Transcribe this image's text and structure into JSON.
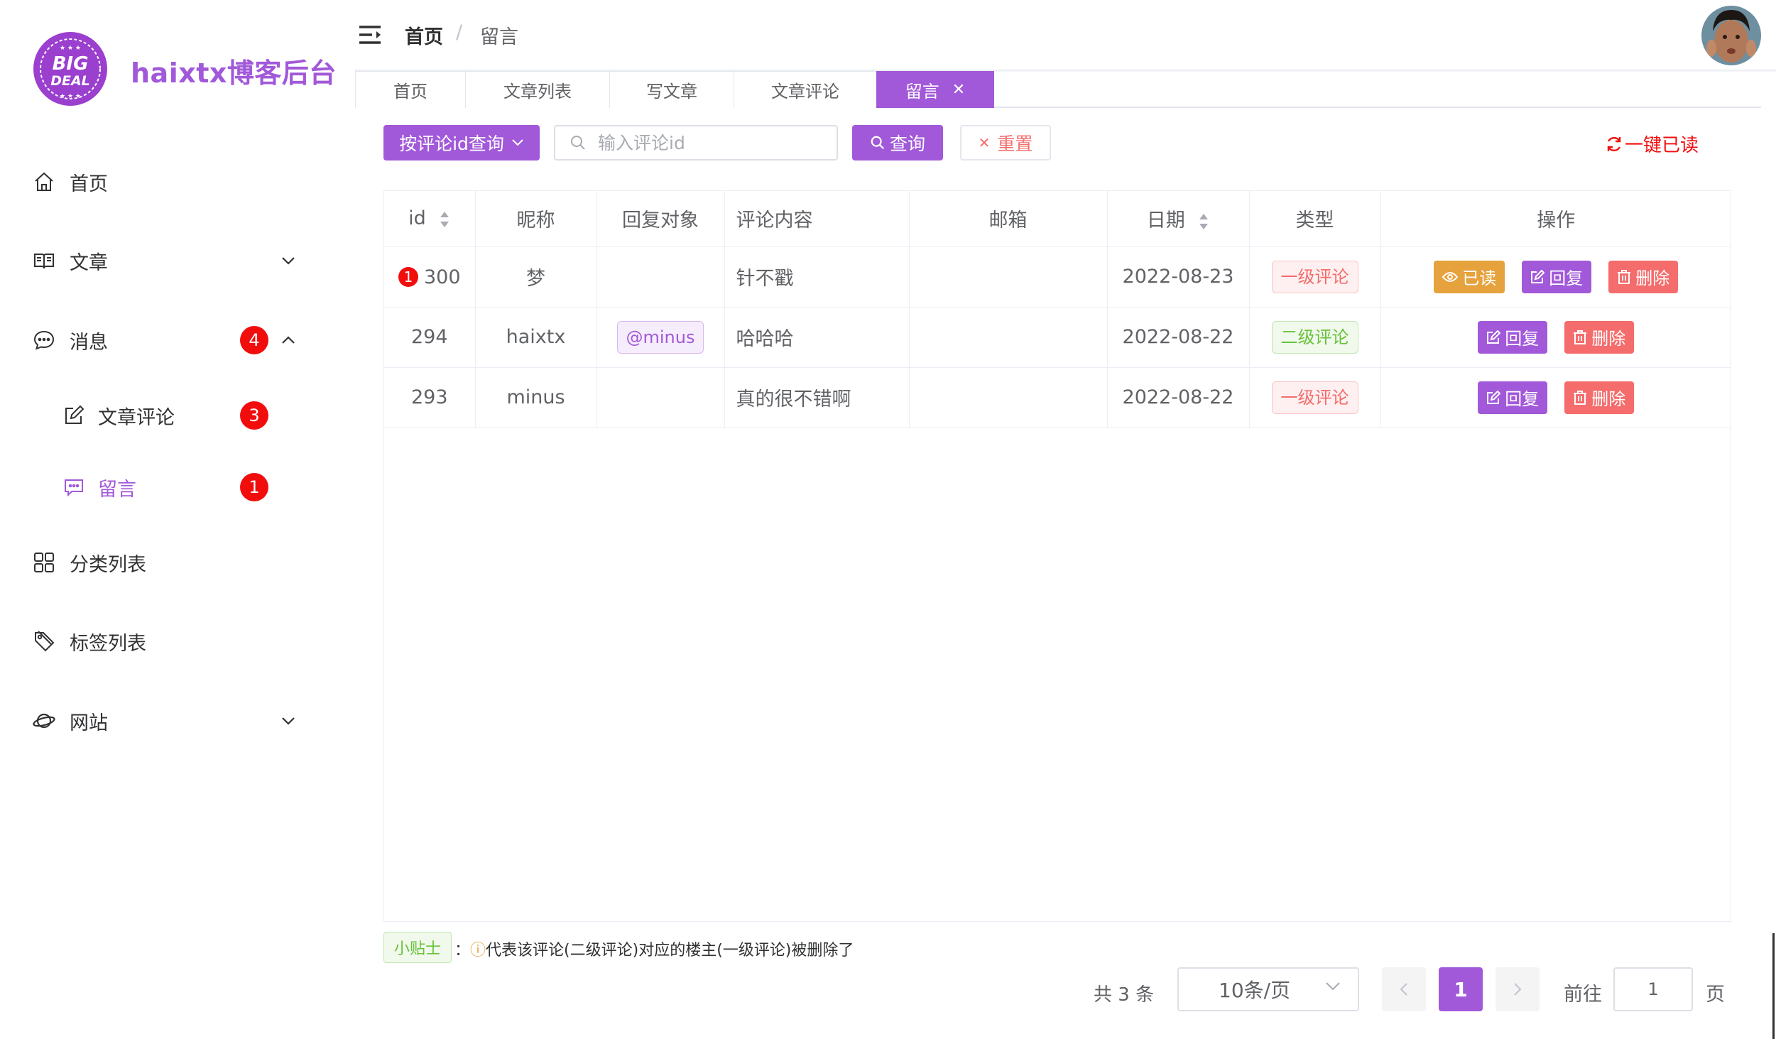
{
  "sidebar": {
    "brand": "haixtx博客后台",
    "logo_text": [
      "BIG",
      "DEAL"
    ],
    "items": [
      {
        "label": "首页",
        "icon": "home-icon"
      },
      {
        "label": "文章",
        "icon": "book-icon"
      },
      {
        "label": "消息",
        "icon": "chat-icon",
        "badge": "4"
      },
      {
        "label": "文章评论",
        "icon": "edit-icon",
        "badge": "3"
      },
      {
        "label": "留言",
        "icon": "message-icon",
        "badge": "1"
      },
      {
        "label": "分类列表",
        "icon": "grid-icon"
      },
      {
        "label": "标签列表",
        "icon": "tag-icon"
      },
      {
        "label": "网站",
        "icon": "planet-icon"
      }
    ]
  },
  "header": {
    "breadcrumb": [
      "首页",
      "/",
      "留言"
    ]
  },
  "tabs": [
    {
      "label": "首页"
    },
    {
      "label": "文章列表"
    },
    {
      "label": "写文章"
    },
    {
      "label": "文章评论"
    },
    {
      "label": "留言",
      "active": true
    }
  ],
  "toolbar": {
    "query_type": "按评论id查询",
    "search_placeholder": "输入评论id",
    "search_label": "查询",
    "reset_label": "重置",
    "mark_all_read": "一键已读"
  },
  "table": {
    "headers": [
      "id",
      "昵称",
      "回复对象",
      "评论内容",
      "邮箱",
      "日期",
      "类型",
      "操作"
    ],
    "rows": [
      {
        "unread_dot": "1",
        "id": "300",
        "nickname": "梦",
        "reply_to": "",
        "content": "针不戳",
        "email": "",
        "date": "2022-08-23",
        "type": "一级评论",
        "actions": [
          "已读",
          "回复",
          "删除"
        ]
      },
      {
        "unread_dot": "",
        "id": "294",
        "nickname": "haixtx",
        "reply_to": "@minus",
        "content": "哈哈哈",
        "email": "",
        "date": "2022-08-22",
        "type": "二级评论",
        "actions": [
          "回复",
          "删除"
        ]
      },
      {
        "unread_dot": "",
        "id": "293",
        "nickname": "minus",
        "reply_to": "",
        "content": "真的很不错啊",
        "email": "",
        "date": "2022-08-22",
        "type": "一级评论",
        "actions": [
          "回复",
          "删除"
        ]
      }
    ]
  },
  "tip": {
    "label": "小贴士",
    "colon": "：",
    "icon_char": "ⓘ",
    "text": "代表该评论(二级评论)对应的楼主(一级评论)被删除了"
  },
  "pagination": {
    "total": "共 3 条",
    "page_size": "10条/页",
    "current": "1",
    "goto_label": "前往",
    "goto_value": "1",
    "page_label": "页"
  },
  "colors": {
    "accent": "#a259d9",
    "danger": "#f56c6c",
    "warning": "#e6a23c",
    "success": "#67c23a",
    "badge": "#f20d0d"
  }
}
